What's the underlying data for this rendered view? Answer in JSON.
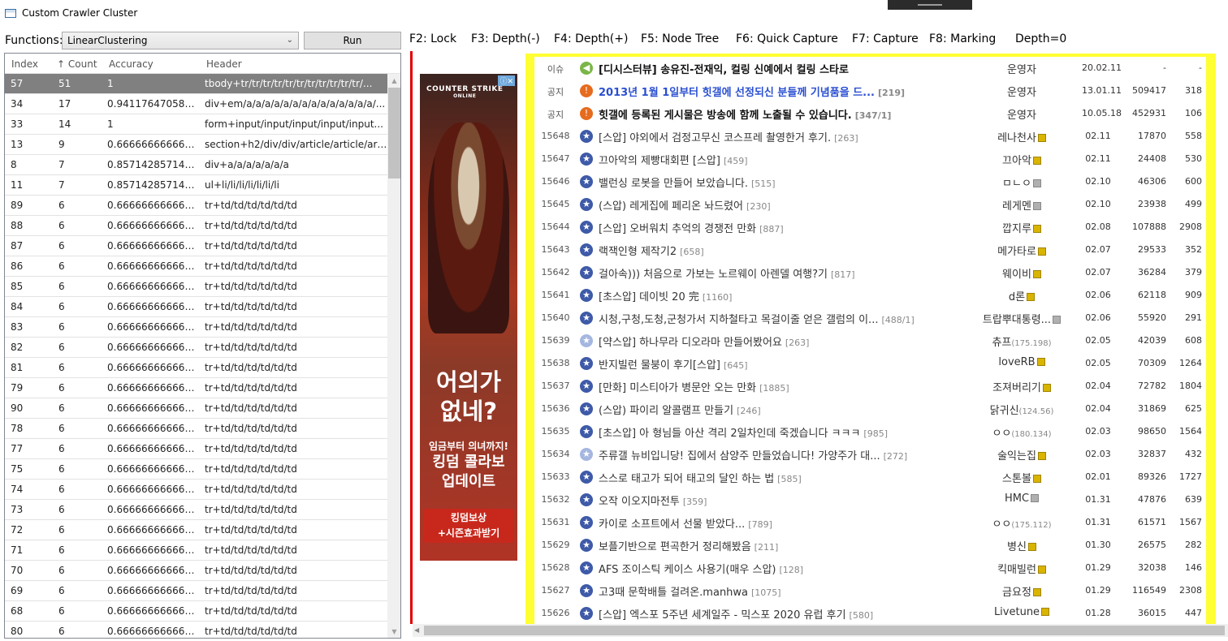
{
  "window": {
    "title": "Custom Crawler Cluster"
  },
  "toolbar": {
    "functions_label": "Functions:",
    "selected_function": "LinearClustering",
    "run_label": "Run"
  },
  "grid": {
    "columns": [
      "Index",
      "Count",
      "Accuracy",
      "Header"
    ],
    "sort_indicator": "↑",
    "rows": [
      {
        "index": "57",
        "count": "51",
        "accuracy": "1",
        "header": "tbody+tr/tr/tr/tr/tr/tr/tr/tr/tr/tr/tr/..."
      },
      {
        "index": "34",
        "count": "17",
        "accuracy": "0.9411764705882...",
        "header": "div+em/a/a/a/a/a/a/a/a/a/a/a/a/a/a/..."
      },
      {
        "index": "33",
        "count": "14",
        "accuracy": "1",
        "header": "form+input/input/input/input/input..."
      },
      {
        "index": "13",
        "count": "9",
        "accuracy": "0.6666666666666...",
        "header": "section+h2/div/div/article/article/art..."
      },
      {
        "index": "8",
        "count": "7",
        "accuracy": "0.8571428571428...",
        "header": "div+a/a/a/a/a/a/a"
      },
      {
        "index": "11",
        "count": "7",
        "accuracy": "0.8571428571428...",
        "header": "ul+li/li/li/li/li/li/li"
      },
      {
        "index": "89",
        "count": "6",
        "accuracy": "0.6666666666666...",
        "header": "tr+td/td/td/td/td/td"
      },
      {
        "index": "88",
        "count": "6",
        "accuracy": "0.6666666666666...",
        "header": "tr+td/td/td/td/td/td"
      },
      {
        "index": "87",
        "count": "6",
        "accuracy": "0.6666666666666...",
        "header": "tr+td/td/td/td/td/td"
      },
      {
        "index": "86",
        "count": "6",
        "accuracy": "0.6666666666666...",
        "header": "tr+td/td/td/td/td/td"
      },
      {
        "index": "85",
        "count": "6",
        "accuracy": "0.6666666666666...",
        "header": "tr+td/td/td/td/td/td"
      },
      {
        "index": "84",
        "count": "6",
        "accuracy": "0.6666666666666...",
        "header": "tr+td/td/td/td/td/td"
      },
      {
        "index": "83",
        "count": "6",
        "accuracy": "0.6666666666666...",
        "header": "tr+td/td/td/td/td/td"
      },
      {
        "index": "82",
        "count": "6",
        "accuracy": "0.6666666666666...",
        "header": "tr+td/td/td/td/td/td"
      },
      {
        "index": "81",
        "count": "6",
        "accuracy": "0.6666666666666...",
        "header": "tr+td/td/td/td/td/td"
      },
      {
        "index": "79",
        "count": "6",
        "accuracy": "0.6666666666666...",
        "header": "tr+td/td/td/td/td/td"
      },
      {
        "index": "90",
        "count": "6",
        "accuracy": "0.6666666666666...",
        "header": "tr+td/td/td/td/td/td"
      },
      {
        "index": "78",
        "count": "6",
        "accuracy": "0.6666666666666...",
        "header": "tr+td/td/td/td/td/td"
      },
      {
        "index": "77",
        "count": "6",
        "accuracy": "0.6666666666666...",
        "header": "tr+td/td/td/td/td/td"
      },
      {
        "index": "75",
        "count": "6",
        "accuracy": "0.6666666666666...",
        "header": "tr+td/td/td/td/td/td"
      },
      {
        "index": "74",
        "count": "6",
        "accuracy": "0.6666666666666...",
        "header": "tr+td/td/td/td/td/td"
      },
      {
        "index": "73",
        "count": "6",
        "accuracy": "0.6666666666666...",
        "header": "tr+td/td/td/td/td/td"
      },
      {
        "index": "72",
        "count": "6",
        "accuracy": "0.6666666666666...",
        "header": "tr+td/td/td/td/td/td"
      },
      {
        "index": "71",
        "count": "6",
        "accuracy": "0.6666666666666...",
        "header": "tr+td/td/td/td/td/td"
      },
      {
        "index": "70",
        "count": "6",
        "accuracy": "0.6666666666666...",
        "header": "tr+td/td/td/td/td/td"
      },
      {
        "index": "69",
        "count": "6",
        "accuracy": "0.6666666666666...",
        "header": "tr+td/td/td/td/td/td"
      },
      {
        "index": "68",
        "count": "6",
        "accuracy": "0.6666666666666...",
        "header": "tr+td/td/td/td/td/td"
      },
      {
        "index": "80",
        "count": "6",
        "accuracy": "0.6666666666666...",
        "header": "tr+td/td/td/td/td/td"
      }
    ]
  },
  "hotkeys": [
    "F2: Lock",
    "F3: Depth(-)",
    "F4: Depth(+)",
    "F5: Node Tree",
    "F6: Quick Capture",
    "F7: Capture",
    "F8: Marking",
    "Depth=0"
  ],
  "ad": {
    "logo": "COUNTER STRIKE",
    "logo_sub": "ONLINE",
    "close": "ⓘ✕",
    "headline": "어의가\n없네?",
    "subline": "임금부터 의녀까지!",
    "line2": "킹덤 콜라보",
    "line3": "업데이트",
    "badge1": "킹덤보상",
    "badge2": "+시즌효과받기"
  },
  "board": {
    "colors": {
      "highlight": "#ffff33",
      "marker": "#e00000",
      "blue_title": "#2a4fd1"
    },
    "posts": [
      {
        "num": "이슈",
        "icon": "speaker",
        "title": "[디시스터뷰] 송유진-전재익, 컬링 신예에서 컬링 스타로",
        "cnt": "",
        "style": "bold",
        "author": "운영자",
        "ip": "",
        "level": "",
        "date": "20.02.11",
        "views": "-",
        "recom": "-"
      },
      {
        "num": "공지",
        "icon": "notice",
        "title": "2013년 1월 1일부터 힛갤에 선정되신 분들께 기념품을 드...",
        "cnt": "[219]",
        "style": "bold blue",
        "author": "운영자",
        "ip": "",
        "level": "",
        "date": "13.01.11",
        "views": "509417",
        "recom": "318"
      },
      {
        "num": "공지",
        "icon": "notice",
        "title": "힛갤에 등록된 게시물은 방송에 함께 노출될 수 있습니다.",
        "cnt": "[347/1]",
        "style": "bold",
        "author": "운영자",
        "ip": "",
        "level": "",
        "date": "10.05.18",
        "views": "452931",
        "recom": "106"
      },
      {
        "num": "15648",
        "icon": "star",
        "title": "[스압] 야외에서 검정고무신 코스프레 촬영한거 후기.",
        "cnt": "[263]",
        "style": "",
        "author": "레나천사",
        "ip": "",
        "level": "gold",
        "date": "02.11",
        "views": "17870",
        "recom": "558"
      },
      {
        "num": "15647",
        "icon": "star",
        "title": "끄아악의 제빵대회편 [스압]",
        "cnt": "[459]",
        "style": "",
        "author": "끄아악",
        "ip": "",
        "level": "gold",
        "date": "02.11",
        "views": "24408",
        "recom": "530"
      },
      {
        "num": "15646",
        "icon": "star",
        "title": "밸런싱 로봇을 만들어 보았습니다.",
        "cnt": "[515]",
        "style": "",
        "author": "ㅁㄴㅇ",
        "ip": "",
        "level": "grey",
        "date": "02.10",
        "views": "46306",
        "recom": "600"
      },
      {
        "num": "15645",
        "icon": "star",
        "title": "(스압) 레게집에 페리온 놔드렸어",
        "cnt": "[230]",
        "style": "",
        "author": "레게멘",
        "ip": "",
        "level": "grey",
        "date": "02.10",
        "views": "23938",
        "recom": "499"
      },
      {
        "num": "15644",
        "icon": "star",
        "title": "[스압] 오버워치 추억의 경쟁전 만화",
        "cnt": "[887]",
        "style": "",
        "author": "깝지루",
        "ip": "",
        "level": "gold",
        "date": "02.08",
        "views": "107888",
        "recom": "2908"
      },
      {
        "num": "15643",
        "icon": "star",
        "title": "랙잭인형 제작기2",
        "cnt": "[658]",
        "style": "",
        "author": "메가타로",
        "ip": "",
        "level": "gold",
        "date": "02.07",
        "views": "29533",
        "recom": "352"
      },
      {
        "num": "15642",
        "icon": "star",
        "title": "걸아속))) 처음으로 가보는 노르웨이 아렌델 여행?기",
        "cnt": "[817]",
        "style": "",
        "author": "웨이비",
        "ip": "",
        "level": "gold",
        "date": "02.07",
        "views": "36284",
        "recom": "379"
      },
      {
        "num": "15641",
        "icon": "star",
        "title": "[초스압] 데이빗 20 完",
        "cnt": "[1160]",
        "style": "",
        "author": "d론",
        "ip": "",
        "level": "gold",
        "date": "02.06",
        "views": "62118",
        "recom": "909"
      },
      {
        "num": "15640",
        "icon": "star",
        "title": "시청,구청,도청,군청가서 지하철타고 목걸이줄 얻은 갤럼의 이...",
        "cnt": "[488/1]",
        "style": "",
        "author": "트랍뿌대통령...",
        "ip": "",
        "level": "grey",
        "date": "02.06",
        "views": "55920",
        "recom": "291"
      },
      {
        "num": "15639",
        "icon": "star-light",
        "title": "[약스압] 하나무라 디오라마 만들어봤어요",
        "cnt": "[263]",
        "style": "",
        "author": "츄프",
        "ip": "(175.198)",
        "level": "",
        "date": "02.05",
        "views": "42039",
        "recom": "608"
      },
      {
        "num": "15638",
        "icon": "star",
        "title": "반지빌런 물붕이 후기[스압]",
        "cnt": "[645]",
        "style": "",
        "author": "loveRB",
        "ip": "",
        "level": "gold",
        "date": "02.05",
        "views": "70309",
        "recom": "1264"
      },
      {
        "num": "15637",
        "icon": "star",
        "title": "[만화] 미스티아가 병문안 오는 만화",
        "cnt": "[1885]",
        "style": "",
        "author": "조져버리기",
        "ip": "",
        "level": "gold",
        "date": "02.04",
        "views": "72782",
        "recom": "1804"
      },
      {
        "num": "15636",
        "icon": "star",
        "title": "(스압) 파이리 알콜램프 만들기",
        "cnt": "[246]",
        "style": "",
        "author": "닭귀신",
        "ip": "(124.56)",
        "level": "",
        "date": "02.04",
        "views": "31869",
        "recom": "625"
      },
      {
        "num": "15635",
        "icon": "star",
        "title": "[초스압] 아 형님들 아산 격리 2일차인데 죽겠습니다 ㅋㅋㅋ",
        "cnt": "[985]",
        "style": "",
        "author": "ㅇㅇ",
        "ip": "(180.134)",
        "level": "",
        "date": "02.03",
        "views": "98650",
        "recom": "1564"
      },
      {
        "num": "15634",
        "icon": "star-light",
        "title": "주류갤 뉴비입니당! 집에서 삼양주 만들었습니다! 가양주가 대...",
        "cnt": "[272]",
        "style": "",
        "author": "술익는집",
        "ip": "",
        "level": "gold",
        "date": "02.03",
        "views": "32837",
        "recom": "432"
      },
      {
        "num": "15633",
        "icon": "star",
        "title": "스스로 태고가 되어 태고의 달인 하는 법",
        "cnt": "[585]",
        "style": "",
        "author": "스톤볼",
        "ip": "",
        "level": "gold",
        "date": "02.01",
        "views": "89326",
        "recom": "1727"
      },
      {
        "num": "15632",
        "icon": "star",
        "title": "오작 이오지마전투",
        "cnt": "[359]",
        "style": "",
        "author": "HMC",
        "ip": "",
        "level": "grey",
        "date": "01.31",
        "views": "47876",
        "recom": "639"
      },
      {
        "num": "15631",
        "icon": "star",
        "title": "카이로 소프트에서 선물 받았다...",
        "cnt": "[789]",
        "style": "",
        "author": "ㅇㅇ",
        "ip": "(175.112)",
        "level": "",
        "date": "01.31",
        "views": "61571",
        "recom": "1567"
      },
      {
        "num": "15629",
        "icon": "star",
        "title": "보플기반으로 편곡한거 정리해봤음",
        "cnt": "[211]",
        "style": "",
        "author": "병신",
        "ip": "",
        "level": "gold",
        "date": "01.30",
        "views": "26575",
        "recom": "282"
      },
      {
        "num": "15628",
        "icon": "star",
        "title": "AFS 조이스틱 케이스 사용기(매우 스압)",
        "cnt": "[128]",
        "style": "",
        "author": "킥매빌런",
        "ip": "",
        "level": "gold",
        "date": "01.29",
        "views": "32038",
        "recom": "146"
      },
      {
        "num": "15627",
        "icon": "star",
        "title": "고3때 문학배틀 걸려온.manhwa",
        "cnt": "[1075]",
        "style": "",
        "author": "금요정",
        "ip": "",
        "level": "gold",
        "date": "01.29",
        "views": "116549",
        "recom": "2308"
      },
      {
        "num": "15626",
        "icon": "star",
        "title": "[스압] 엑스포 5주년 세계일주 - 믹스포 2020 유럽 후기",
        "cnt": "[580]",
        "style": "",
        "author": "Livetune",
        "ip": "",
        "level": "gold",
        "date": "01.28",
        "views": "36015",
        "recom": "447"
      }
    ]
  }
}
